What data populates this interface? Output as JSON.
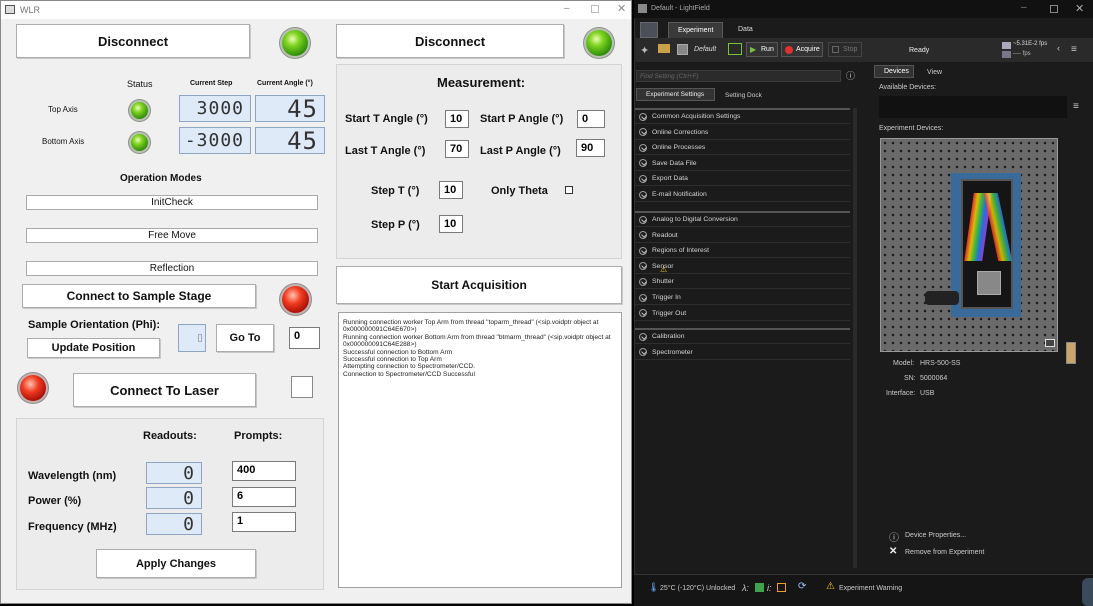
{
  "wlr": {
    "title": "WLR",
    "left_disconnect": "Disconnect",
    "right_disconnect": "Disconnect",
    "status_header": "Status",
    "current_step_header": "Current Step",
    "current_angle_header": "Current Angle (°)",
    "top_axis_label": "Top Axis",
    "bottom_axis_label": "Bottom Axis",
    "top_step": "3000",
    "top_angle": "45",
    "bottom_step": "-3000",
    "bottom_angle": "45",
    "operation_modes": "Operation Modes",
    "mode_initcheck": "InitCheck",
    "mode_freemove": "Free Move",
    "mode_reflection": "Reflection",
    "connect_sample_stage": "Connect to Sample Stage",
    "sample_orientation": "Sample Orientation (Phi):",
    "update_position": "Update Position",
    "go_to": "Go To",
    "phi_value": "0",
    "connect_laser": "Connect To Laser",
    "readouts": "Readouts:",
    "prompts": "Prompts:",
    "wavelength_label": "Wavelength (nm)",
    "power_label": "Power (%)",
    "frequency_label": "Frequency (MHz)",
    "wavelength_readout": "0",
    "power_readout": "0",
    "frequency_readout": "0",
    "wavelength_prompt": "400",
    "power_prompt": "6",
    "frequency_prompt": "1",
    "apply_changes": "Apply Changes",
    "measurement": "Measurement:",
    "start_t_label": "Start T Angle (°)",
    "start_t": "10",
    "start_p_label": "Start P Angle (°)",
    "start_p": "0",
    "last_t_label": "Last T Angle (°)",
    "last_t": "70",
    "last_p_label": "Last P Angle (°)",
    "last_p": "90",
    "step_t_label": "Step T (°)",
    "step_t": "10",
    "only_theta": "Only Theta",
    "step_p_label": "Step P (°)",
    "step_p": "10",
    "start_acquisition": "Start Acquisition",
    "log": "Running connection worker Top Arm from thread \"toparm_thread\" (<sip.voidptr object at 0x000000091C64E670>)\nRunning connection worker Bottom Arm from thread \"btmarm_thread\" (<sip.voidptr object at 0x000000091C64E288>)\nSuccessful connection to Bottom Arm\nSuccessful connection to Top Arm\nAttempting connection to Spectrometer/CCD.\nConnection to Spectrometer/CCD Successful"
  },
  "lightfield": {
    "title": "Default - LightField",
    "tab_experiment": "Experiment",
    "tab_data": "Data",
    "default": "Default",
    "run": "Run",
    "acquire": "Acquire",
    "stop": "Stop",
    "status": "Ready",
    "rate1": "~5.31E-2 fps",
    "rate2": "---- fps",
    "find_setting": "Find Setting (Ctrl+F)",
    "tab_exp_settings": "Experiment Settings",
    "tab_setting_dock": "Setting Dock",
    "settings_group1": [
      "Common Acquisition Settings",
      "Online Corrections",
      "Online Processes",
      "Save Data File",
      "Export Data",
      "E-mail Notification"
    ],
    "settings_group2": [
      "Analog to Digital Conversion",
      "Readout",
      "Regions of Interest",
      "Sensor",
      "Shutter",
      "Trigger In",
      "Trigger Out"
    ],
    "settings_group3": [
      "Calibration",
      "Spectrometer"
    ],
    "tab_devices": "Devices",
    "tab_view": "View",
    "available_devices": "Available Devices:",
    "experiment_devices": "Experiment Devices:",
    "model_label": "Model:",
    "model": "HRS-500-SS",
    "sn_label": "SN:",
    "sn": "5000064",
    "interface_label": "Interface:",
    "interface": "USB",
    "device_properties": "Device Properties...",
    "remove_from_experiment": "Remove from Experiment",
    "temperature": "25°C (-120°C) Unlocked",
    "lambda": "λ:",
    "i_label": "i:",
    "warning": "Experiment Warning"
  },
  "colors": {
    "led_green": "#3c9a0e",
    "led_red": "#b0130a",
    "lf_bg": "#1b1b1b",
    "acquire_red": "#e03030"
  }
}
